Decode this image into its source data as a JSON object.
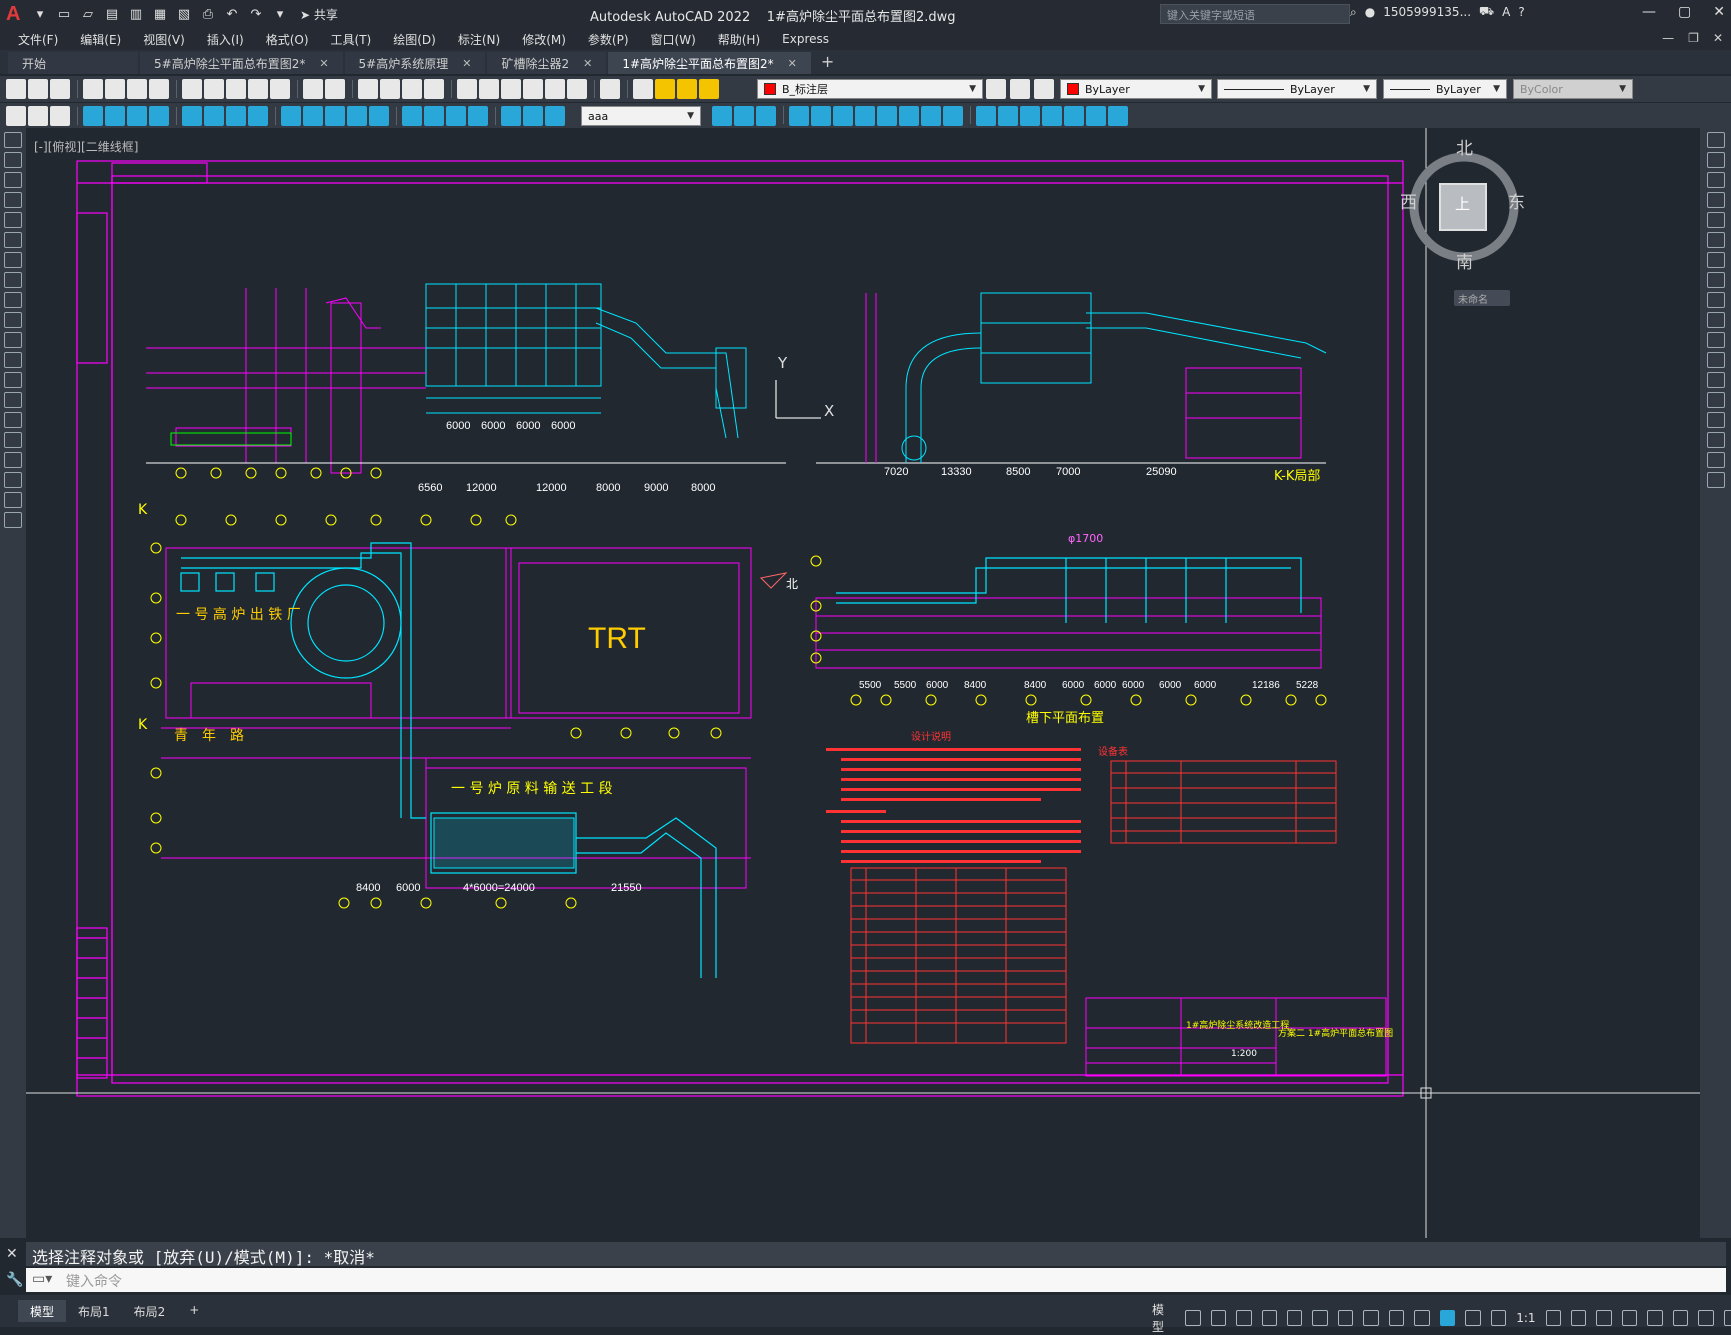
{
  "titlebar": {
    "app_letter": "A",
    "share_label": "共享",
    "app_name": "Autodesk AutoCAD 2022",
    "file_name": "1#高炉除尘平面总布置图2.dwg",
    "search_placeholder": "键入关键字或短语",
    "user": "1505999135...",
    "window_controls": [
      "—",
      "▢",
      "✕"
    ]
  },
  "menu": {
    "items": [
      "文件(F)",
      "编辑(E)",
      "视图(V)",
      "插入(I)",
      "格式(O)",
      "工具(T)",
      "绘图(D)",
      "标注(N)",
      "修改(M)",
      "参数(P)",
      "窗口(W)",
      "帮助(H)",
      "Express"
    ]
  },
  "tabs": [
    {
      "label": "开始",
      "active": false,
      "closable": false
    },
    {
      "label": "5#高炉除尘平面总布置图2*",
      "active": false,
      "closable": true
    },
    {
      "label": "5#高炉系统原理",
      "active": false,
      "closable": true
    },
    {
      "label": "矿槽除尘器2",
      "active": false,
      "closable": true
    },
    {
      "label": "1#高炉除尘平面总布置图2*",
      "active": true,
      "closable": true
    }
  ],
  "toolbar1": {
    "layer_name": "B_标注层",
    "color": "ByLayer",
    "linetype": "ByLayer",
    "lineweight": "ByLayer",
    "plotstyle": "ByColor"
  },
  "toolbar2": {
    "text_style": "aaa"
  },
  "viewport": {
    "label": "[-][俯视][二维线框]",
    "ucs_x": "X",
    "ucs_y": "Y"
  },
  "viewcube": {
    "north": "北",
    "south": "南",
    "east": "东",
    "west": "西",
    "face": "上",
    "unnamed": "未命名"
  },
  "drawing": {
    "trt_label": "TRT",
    "k_marker": "K",
    "kk_label": "K-K局部",
    "trough_label": "槽下平面布置",
    "north_label": "北",
    "blast_furnace": "一 号 高 炉 出 铁 厂",
    "qingnian": "青　年　路",
    "feed_section": "一 号 炉 原 料 输 送 工 段",
    "dims_top": [
      "6560",
      "12000",
      "12000",
      "8000",
      "9000",
      "8000"
    ],
    "dims_top2": [
      "6000",
      "6000",
      "6000",
      "6000"
    ],
    "dims_mid": [
      "7020",
      "13330",
      "8500",
      "7000",
      "25090"
    ],
    "dims_trough": [
      "5500",
      "5500",
      "6000",
      "8400",
      "8400",
      "6000",
      "6000",
      "6000",
      "6000",
      "6000",
      "12186",
      "5228"
    ],
    "dims_bottom": [
      "8400",
      "6000",
      "4*6000=24000",
      "21550"
    ],
    "pipe_label": "φ1700",
    "title_block_project": "1#高炉除尘系统改造工程",
    "title_block_drawing": "方案二 1#高炉平面总布置图",
    "title_block_scale": "1:200",
    "table_title": "设备表",
    "notes_title": "设计说明"
  },
  "command": {
    "history": "选择注释对象或 [放弃(U)/模式(M)]: *取消*",
    "placeholder": "键入命令"
  },
  "status": {
    "layouts": [
      "模型",
      "布局1",
      "布局2"
    ],
    "model_label": "模型",
    "scale": "1:1"
  }
}
